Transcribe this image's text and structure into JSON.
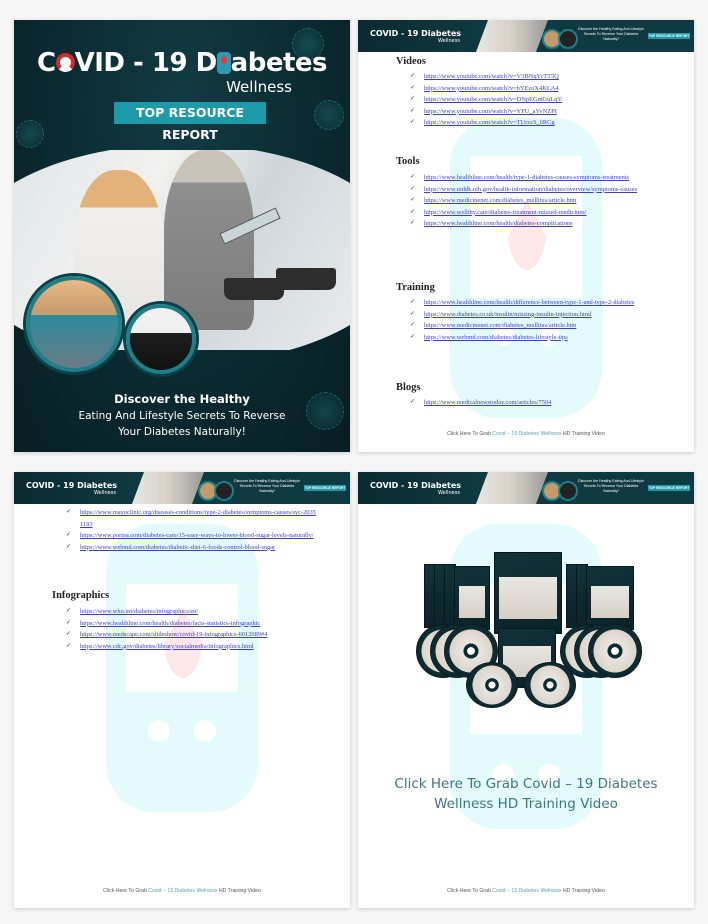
{
  "cover": {
    "title_prefix": "C",
    "title_mid": "VID - 19 D",
    "title_suffix": "abetes",
    "subtitle": "Wellness",
    "badge": "TOP RESOURCE REPORT",
    "tagline_bold": "Discover the Healthy",
    "tagline_line2": "Eating And Lifestyle Secrets To Reverse",
    "tagline_line3": "Your Diabetes Naturally!"
  },
  "banner": {
    "logo": "COVID - 19 Diabetes",
    "logo_sub": "Wellness",
    "tagline": "Discover the Healthy Eating And Lifestyle Secrets To Reverse Your Diabetes Naturally!",
    "badge": "TOP RESOURCE REPORT"
  },
  "page2": {
    "sections": [
      {
        "title": "Videos",
        "links": [
          "https://www.youtube.com/watch?v=V3BNqYrTT5Q",
          "https://www.youtube.com/watch?v=bYEzoX4KLA4",
          "https://www.youtube.com/watch?v=DNpEGmGuLqY",
          "https://www.youtube.com/watch?v=YFU_aYvNZPI",
          "https://www.youtube.com/watch?v=TUrzzS_6RCg"
        ]
      },
      {
        "title": "Tools",
        "links": [
          "https://www.healthline.com/health/type-1-diabetes-causes-symptoms-treatments",
          "https://www.niddk.nih.gov/health-information/diabetes/overview/symptoms-causes",
          "https://www.medicinenet.com/diabetes_mellitus/article.htm",
          "https://www.wellthy.care/diabetes-treatment-missed-medicines/",
          "https://www.healthline.com/health/diabetes-complications"
        ]
      },
      {
        "title": "Training",
        "links": [
          "https://www.healthline.com/health/difference-between-type-1-and-type-2-diabetes",
          "https://www.diabetes.co.uk/insulin/missing-insulin-injection.html",
          "https://www.medicinenet.com/diabetes_mellitus/article.htm",
          "https://www.webmd.com/diabetes/diabetes-lifestyle-tips"
        ]
      },
      {
        "title": "Blogs",
        "links": [
          "https://www.medicalnewstoday.com/articles/7504"
        ]
      }
    ]
  },
  "page3": {
    "continued_links": [
      "https://www.mayoclinic.org/diseases-conditions/type-2-diabetes/symptoms-causes/syc-20351193",
      "https://www.portea.com/diabetes-care/15-easy-ways-to-lower-blood-sugar-levels-naturally/",
      "https://www.webmd.com/diabetes/diabetic-diet-6-foods-control-blood-sugar"
    ],
    "sections": [
      {
        "title": "Infographics",
        "links": [
          "https://www.who.int/diabetes/infographics/en/",
          "https://www.healthline.com/health/diabetes/facts-statistics-infographic",
          "https://www.medscape.com/slideshow/covid-19-infographics-6012689#4",
          "https://www.cdc.gov/diabetes/library/socialmedia/infographics.html"
        ]
      }
    ]
  },
  "page4": {
    "cta_line1": "Click Here To Grab Covid – 19 Diabetes",
    "cta_line2": "Wellness HD Training Video"
  },
  "footer": {
    "prefix": "Click Here To Grab ",
    "highlight": "Covid – 19 Diabetes Wellness",
    "suffix": " HD Training Video"
  },
  "colors": {
    "cover_bg": "#0b2a31",
    "accent_teal": "#1d9aa8",
    "link": "#3a3ae6",
    "cta": "#3c7880"
  }
}
